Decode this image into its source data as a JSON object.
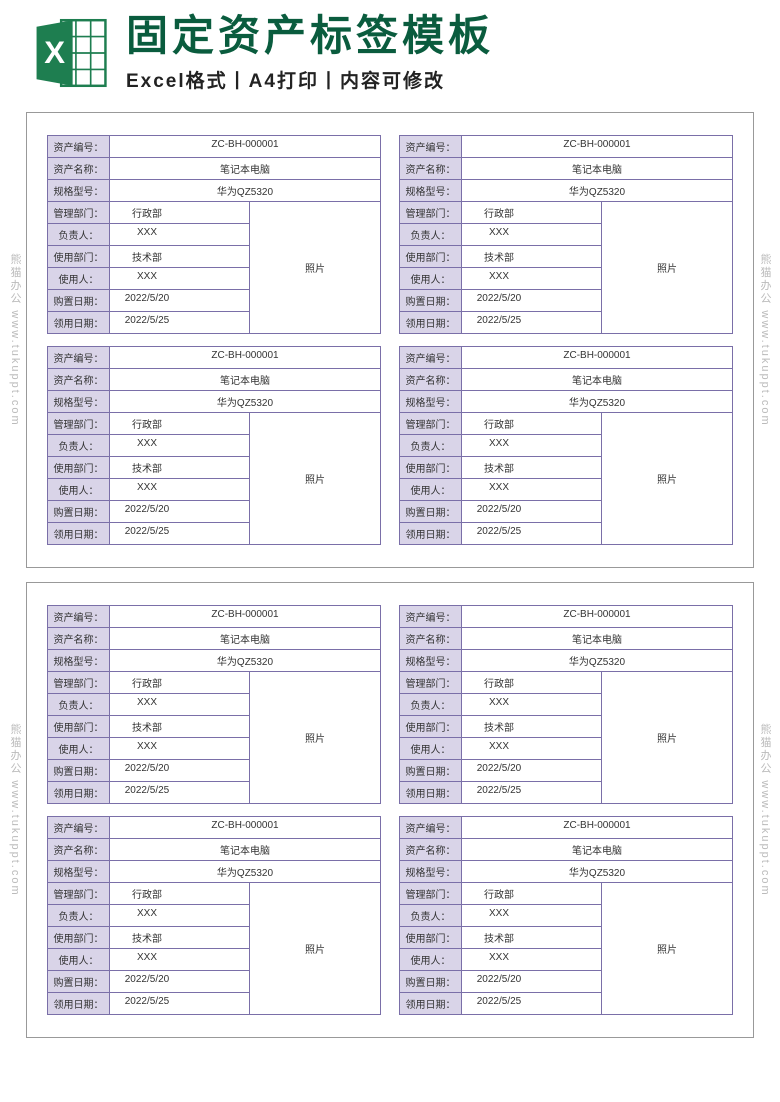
{
  "header": {
    "title": "固定资产标签模板",
    "subtitle": "Excel格式丨A4打印丨内容可修改"
  },
  "watermark": "熊猫办公 www.tukuppt.com",
  "labels": {
    "asset_no": "资产编号：",
    "asset_name": "资产名称：",
    "spec": "规格型号：",
    "dept": "管理部门：",
    "owner": "负责人：",
    "use_dept": "使用部门：",
    "user": "使用人：",
    "buy_date": "购置日期：",
    "recv_date": "领用日期：",
    "photo": "照片"
  },
  "card": {
    "asset_no": "ZC-BH-000001",
    "asset_name": "笔记本电脑",
    "spec": "华为QZ5320",
    "dept": "行政部",
    "owner": "XXX",
    "use_dept": "技术部",
    "user": "XXX",
    "buy_date": "2022/5/20",
    "recv_date": "2022/5/25"
  }
}
